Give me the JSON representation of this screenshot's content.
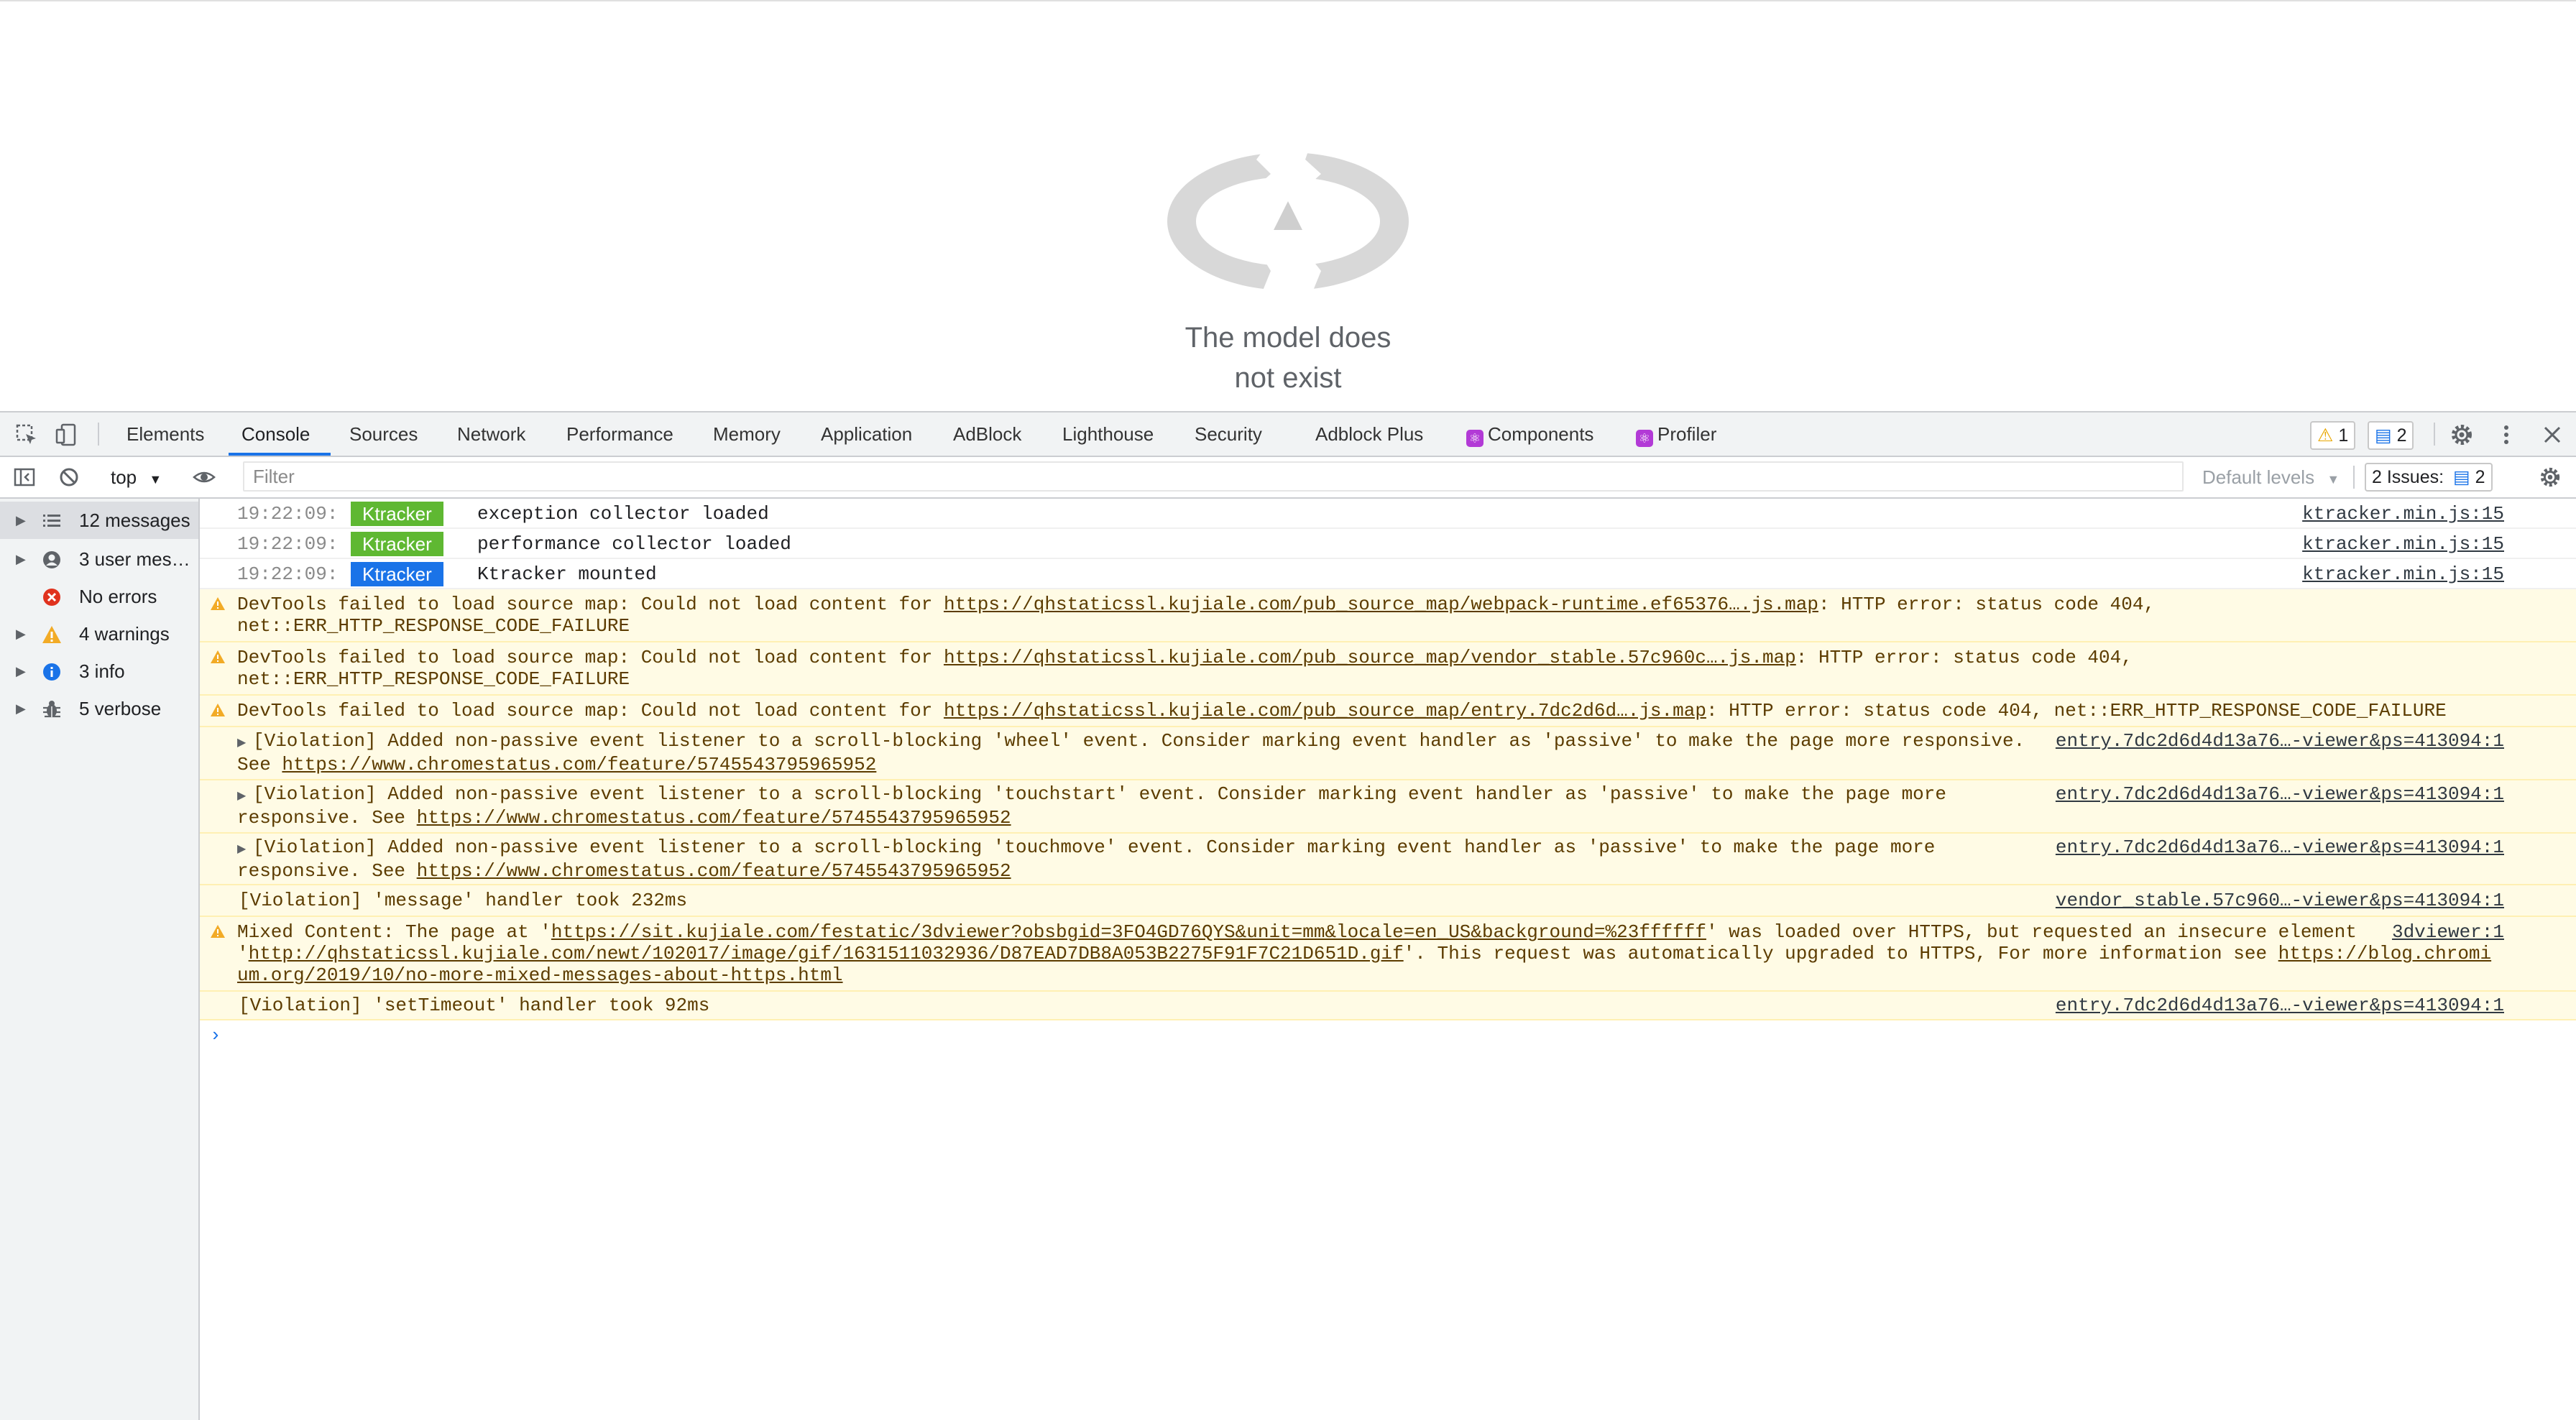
{
  "page": {
    "model_message_line1": "The model does",
    "model_message_line2": "not exist"
  },
  "devtools": {
    "tabs": [
      "Elements",
      "Console",
      "Sources",
      "Network",
      "Performance",
      "Memory",
      "Application",
      "AdBlock",
      "Lighthouse",
      "Security",
      "Adblock Plus",
      "Components",
      "Profiler"
    ],
    "active_tab": "Console",
    "warning_count": "1",
    "info_count": "2",
    "context": "top",
    "filter_placeholder": "Filter",
    "levels_label": "Default levels",
    "issues_label": "2 Issues:",
    "issues_count": "2"
  },
  "sidebar": {
    "items": [
      {
        "label": "12 messages",
        "icon": "list-icon"
      },
      {
        "label": "3 user mes…",
        "icon": "user-icon"
      },
      {
        "label": "No errors",
        "icon": "error-icon"
      },
      {
        "label": "4 warnings",
        "icon": "warning-icon"
      },
      {
        "label": "3 info",
        "icon": "info-icon"
      },
      {
        "label": "5 verbose",
        "icon": "bug-icon"
      }
    ]
  },
  "console": {
    "messages": [
      {
        "time": "19:22:09:",
        "badge": "Ktracker",
        "badge_color": "#5fb832",
        "text": "exception collector loaded",
        "source": "ktracker.min.js:15"
      },
      {
        "time": "19:22:09:",
        "badge": "Ktracker",
        "badge_color": "#5fb832",
        "text": "performance collector loaded",
        "source": "ktracker.min.js:15"
      },
      {
        "time": "19:22:09:",
        "badge": "Ktracker",
        "badge_color": "#1a73e8",
        "text": "Ktracker mounted",
        "source": "ktracker.min.js:15"
      }
    ],
    "warn1": {
      "prefix": "DevTools failed to load source map: Could not load content for ",
      "link": "https://qhstaticssl.kujiale.com/pub_source_map/webpack-runtime.ef65376….js.map",
      "suffix": ": HTTP error: status code 404,",
      "line2": "net::ERR_HTTP_RESPONSE_CODE_FAILURE"
    },
    "warn2": {
      "prefix": "DevTools failed to load source map: Could not load content for ",
      "link": "https://qhstaticssl.kujiale.com/pub_source_map/vendor_stable.57c960c….js.map",
      "suffix": ": HTTP error: status code 404,",
      "line2": "net::ERR_HTTP_RESPONSE_CODE_FAILURE"
    },
    "warn3": {
      "prefix": "DevTools failed to load source map: Could not load content for ",
      "link": "https://qhstaticssl.kujiale.com/pub_source_map/entry.7dc2d6d….js.map",
      "suffix": ": HTTP error: status code 404, net::ERR_HTTP_RESPONSE_CODE_FAILURE"
    },
    "violation_wheel": {
      "line1": "[Violation] Added non-passive event listener to a scroll-blocking 'wheel' event. Consider marking event handler as 'passive' to make the page more responsive.",
      "line2_prefix": "See ",
      "link": "https://www.chromestatus.com/feature/5745543795965952",
      "source": "entry.7dc2d6d4d13a76…-viewer&ps=413094:1"
    },
    "violation_touchstart": {
      "line1": "[Violation] Added non-passive event listener to a scroll-blocking 'touchstart' event. Consider marking event handler as 'passive' to make the page more",
      "line2_prefix": "responsive. See ",
      "link": "https://www.chromestatus.com/feature/5745543795965952",
      "source": "entry.7dc2d6d4d13a76…-viewer&ps=413094:1"
    },
    "violation_touchmove": {
      "line1": "[Violation] Added non-passive event listener to a scroll-blocking 'touchmove' event. Consider marking event handler as 'passive' to make the page more",
      "line2_prefix": "responsive. See ",
      "link": "https://www.chromestatus.com/feature/5745543795965952",
      "source": "entry.7dc2d6d4d13a76…-viewer&ps=413094:1"
    },
    "violation_message": {
      "text": "[Violation] 'message' handler took 232ms",
      "source": "vendor_stable.57c960…-viewer&ps=413094:1"
    },
    "mixed": {
      "p1": "Mixed Content: The page at '",
      "link1": "https://sit.kujiale.com/festatic/3dviewer?obsbgid=3FO4GD76QYS&unit=mm&locale=en_US&background=%23ffffff",
      "p2": "' was loaded over HTTPS, but requested an insecure element",
      "q": "'",
      "link2": "http://qhstaticssl.kujiale.com/newt/102017/image/gif/1631511032936/D87EAD7DB8A053B2275F91F7C21D651D.gif",
      "p3": "'. This request was automatically upgraded to HTTPS, For more information see ",
      "link3a": "https://blog.chromi",
      "link3b": "um.org/2019/10/no-more-mixed-messages-about-https.html",
      "source": "3dviewer:1"
    },
    "violation_timeout": {
      "text": "[Violation] 'setTimeout' handler took 92ms",
      "source": "entry.7dc2d6d4d13a76…-viewer&ps=413094:1"
    }
  },
  "colors": {
    "accent": "#1a73e8",
    "warn_bg": "#fffbe5",
    "ktracker_green": "#5fb832"
  }
}
